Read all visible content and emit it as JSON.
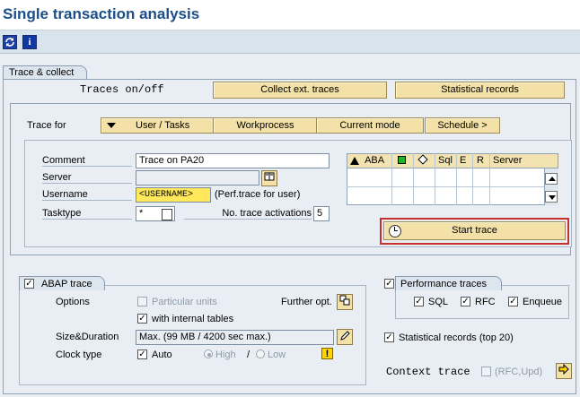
{
  "window": {
    "title": "Single transaction analysis"
  },
  "toolbar": {
    "refresh_icon": "refresh-icon",
    "info_label": "i"
  },
  "trace_collect": {
    "tab_label": "Trace & collect",
    "traces_onoff": "Traces on/off",
    "collect_ext_traces": "Collect ext. traces",
    "statistical_records": "Statistical records"
  },
  "trace_for": {
    "label": "Trace for",
    "buttons": {
      "user_tasks": "User / Tasks",
      "workprocess": "Workprocess",
      "current_mode": "Current mode",
      "schedule": "Schedule >"
    }
  },
  "fields": {
    "comment_label": "Comment",
    "comment_value": "Trace on PA20",
    "server_label": "Server",
    "server_value": "",
    "username_label": "Username",
    "username_value": "<USERNAME>",
    "username_note": "(Perf.trace for user)",
    "tasktype_label": "Tasktype",
    "tasktype_value": "*",
    "no_trace_label": "No. trace activations",
    "no_trace_value": "5"
  },
  "grid": {
    "columns": [
      "ABA",
      "",
      "",
      "Sql",
      "E",
      "R",
      "Server"
    ]
  },
  "start_trace": {
    "label": "Start trace"
  },
  "abap_trace": {
    "tab_label": "ABAP trace",
    "checked": true,
    "options_label": "Options",
    "particular_units": "Particular units",
    "further_opt": "Further opt.",
    "internal_tables": "with internal tables",
    "size_duration_label": "Size&Duration",
    "size_duration_value": "Max. (99 MB / 4200 sec max.)",
    "clock_type_label": "Clock type",
    "auto": "Auto",
    "high": "High",
    "slash": "/",
    "low": "Low"
  },
  "performance_traces": {
    "tab_label": "Performance traces",
    "checked": true,
    "sql": "SQL",
    "rfc": "RFC",
    "enqueue": "Enqueue"
  },
  "statistical_records_top": {
    "label": "Statistical records (top 20)",
    "checked": true
  },
  "context_trace": {
    "label": "Context trace",
    "rfc_upd": "(RFC,Upd)"
  }
}
